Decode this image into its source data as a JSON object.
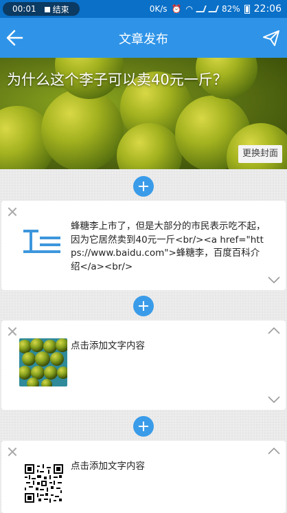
{
  "status_bar": {
    "time_pill": "00:01",
    "end_label": "结束",
    "net_speed": "0K/s",
    "battery": "82%",
    "clock": "22:06"
  },
  "app_bar": {
    "title": "文章发布"
  },
  "cover": {
    "title": "为什么这个李子可以卖40元一斤？",
    "change_button": "更换封面"
  },
  "blocks": [
    {
      "type": "text",
      "content": "蜂糖李上市了，但是大部分的市民表示吃不起，因为它居然卖到40元一斤<br/><a href=\"https://www.baidu.com\">蜂糖李，百度百科介绍</a><br/>"
    },
    {
      "type": "image",
      "caption": "点击添加文字内容"
    },
    {
      "type": "image",
      "caption": "点击添加文字内容"
    }
  ],
  "colors": {
    "primary": "#2f94e8",
    "status": "#0a70c8",
    "add": "#3a9ce9"
  }
}
